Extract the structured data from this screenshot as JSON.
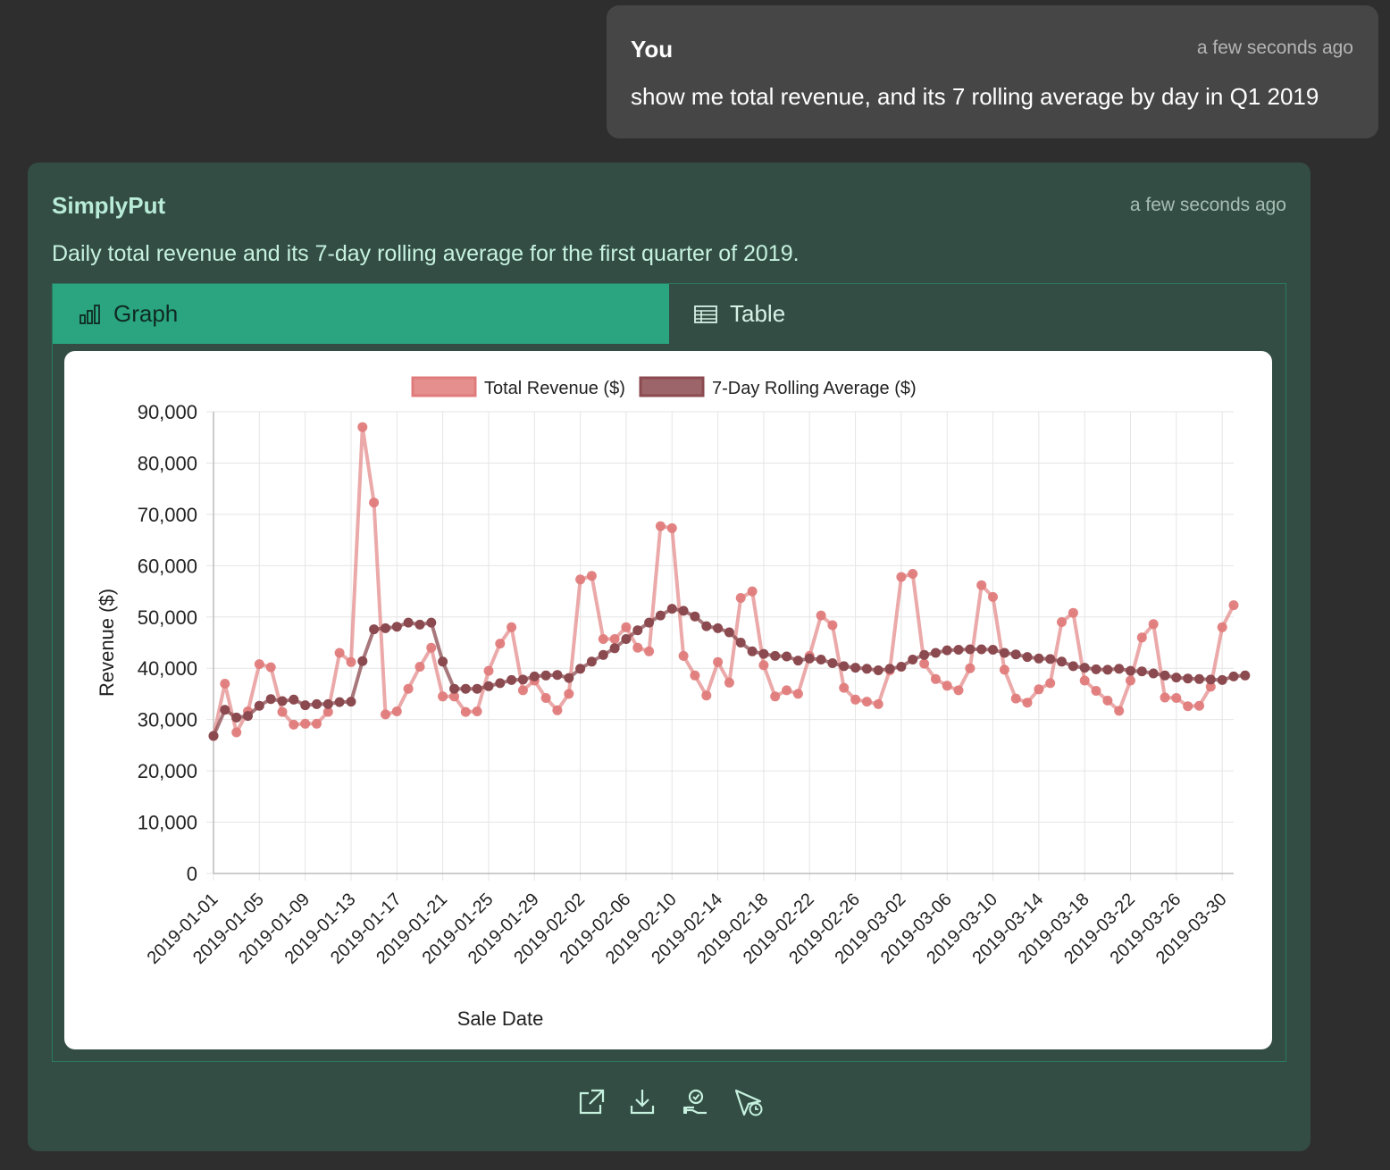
{
  "user_message": {
    "author": "You",
    "time": "a few seconds ago",
    "text": "show me total revenue, and its 7 rolling average by day in Q1 2019"
  },
  "bot_message": {
    "author": "SimplyPut",
    "time": "a few seconds ago",
    "text": "Daily total revenue and its 7-day rolling average for the first quarter of 2019.",
    "tabs": [
      {
        "label": "Graph",
        "icon": "bar-chart-icon",
        "active": true
      },
      {
        "label": "Table",
        "icon": "table-icon",
        "active": false
      }
    ],
    "actions": [
      "open-external-icon",
      "download-icon",
      "verify-icon",
      "schedule-send-icon"
    ]
  },
  "colors": {
    "revenue": "#e07b7b",
    "rolling": "#8b4a4f",
    "tab_active": "#2aa57f"
  },
  "chart_data": {
    "type": "line",
    "xlabel": "Sale Date",
    "ylabel": "Revenue ($)",
    "ylim": [
      0,
      90000
    ],
    "yticks": [
      "90,000",
      "80,000",
      "70,000",
      "60,000",
      "50,000",
      "40,000",
      "30,000",
      "20,000",
      "10,000",
      "0"
    ],
    "xticks": [
      "2019-01-01",
      "2019-01-05",
      "2019-01-09",
      "2019-01-13",
      "2019-01-17",
      "2019-01-21",
      "2019-01-25",
      "2019-01-29",
      "2019-02-02",
      "2019-02-06",
      "2019-02-10",
      "2019-02-14",
      "2019-02-18",
      "2019-02-22",
      "2019-02-26",
      "2019-03-02",
      "2019-03-06",
      "2019-03-10",
      "2019-03-14",
      "2019-03-18",
      "2019-03-22",
      "2019-03-26",
      "2019-03-30"
    ],
    "x_start": "2019-01-01",
    "x_end": "2019-03-31",
    "legend_position": "top",
    "grid": true,
    "series": [
      {
        "name": "Total Revenue ($)",
        "values": [
          26800,
          37000,
          27500,
          31600,
          40800,
          40200,
          31500,
          29000,
          29200,
          29200,
          31500,
          43000,
          41200,
          87000,
          72300,
          31000,
          31600,
          36000,
          40300,
          44000,
          34500,
          34500,
          31500,
          31600,
          39500,
          44800,
          48000,
          35700,
          37600,
          34200,
          31800,
          35000,
          57300,
          58000,
          45700,
          45700,
          48000,
          44000,
          43300,
          67700,
          67300,
          42400,
          38600,
          34700,
          41200,
          37200,
          53700,
          55000,
          40600,
          34500,
          35700,
          35000,
          42400,
          50300,
          48400,
          36200,
          33900,
          33500,
          33000,
          39600,
          57800,
          58400,
          40900,
          37900,
          36600,
          35700,
          40000,
          56200,
          53900,
          39700,
          34100,
          33300,
          35900,
          37100,
          49000,
          50800,
          37600,
          35600,
          33700,
          31700,
          37600,
          46000,
          48600,
          34300,
          34200,
          32600,
          32700,
          36400,
          48000,
          52300
        ],
        "color": "#e07b7b"
      },
      {
        "name": "7-Day Rolling Average ($)",
        "values": [
          26800,
          31900,
          30400,
          30700,
          32700,
          34000,
          33600,
          33900,
          32800,
          33000,
          33000,
          33400,
          33500,
          41400,
          47600,
          47800,
          48100,
          48900,
          48500,
          48900,
          41300,
          36000,
          36000,
          36000,
          36500,
          37100,
          37700,
          37800,
          38400,
          38600,
          38700,
          38100,
          39900,
          41300,
          42600,
          43900,
          45700,
          47400,
          48900,
          50300,
          51600,
          51200,
          50100,
          48200,
          47800,
          47000,
          45000,
          43300,
          42800,
          42400,
          42300,
          41500,
          41900,
          41700,
          41000,
          40400,
          40100,
          39900,
          39600,
          39900,
          40300,
          41700,
          42600,
          43000,
          43500,
          43600,
          43700,
          43700,
          43600,
          43000,
          42700,
          42200,
          41900,
          41800,
          41300,
          40400,
          40100,
          39800,
          39700,
          39900,
          39500,
          39400,
          39000,
          38600,
          38200,
          38000,
          37900,
          37800,
          37700,
          38400,
          38600
        ],
        "color": "#8b4a4f"
      }
    ]
  }
}
